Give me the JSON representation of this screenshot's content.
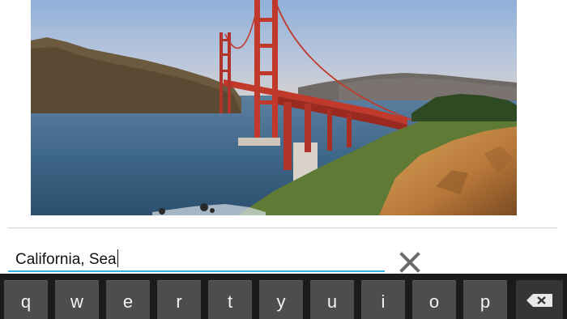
{
  "photo": {
    "subject": "golden-gate-bridge"
  },
  "caption": {
    "value": "California, Sea"
  },
  "clear_icon": "close-icon",
  "keyboard": {
    "keys": [
      "q",
      "w",
      "e",
      "r",
      "t",
      "y",
      "u",
      "i",
      "o",
      "p"
    ],
    "backspace_icon": "backspace-icon"
  },
  "colors": {
    "input_underline": "#33b5e5",
    "keyboard_bg": "#1b1b1b",
    "key_bg": "#4b4d4f",
    "bridge": "#c1392b"
  }
}
